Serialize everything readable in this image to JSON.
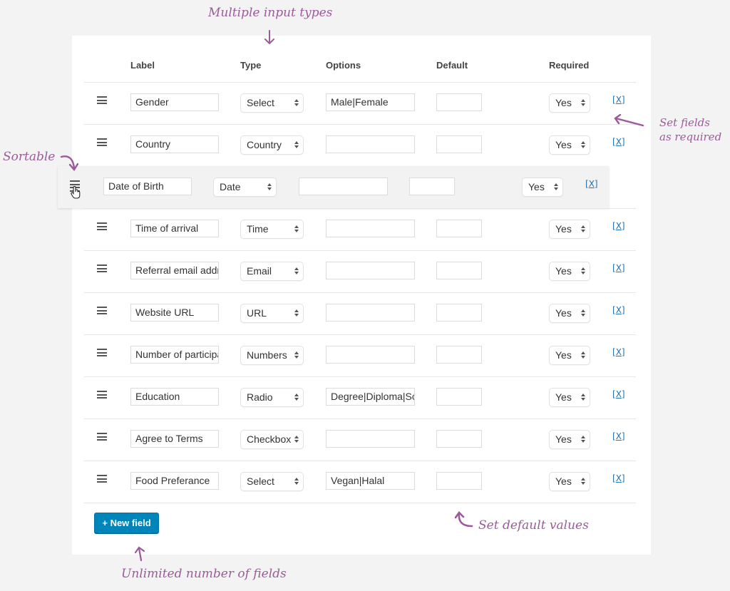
{
  "annotations": {
    "input_types": "Multiple input types",
    "sortable": "Sortable",
    "required": [
      "Set fields",
      "as required"
    ],
    "default_values": "Set default values",
    "unlimited": "Unlimited number of fields"
  },
  "table": {
    "headers": {
      "label": "Label",
      "type": "Type",
      "options": "Options",
      "default": "Default",
      "required": "Required"
    },
    "delete_label_open": "[",
    "delete_label_x": "X",
    "delete_label_close": "]",
    "rows": [
      {
        "label": "Gender",
        "type": "Select",
        "options": "Male|Female",
        "default": "",
        "required": "Yes"
      },
      {
        "label": "Country",
        "type": "Country",
        "options": "",
        "default": "",
        "required": "Yes"
      },
      {
        "label": "Date of Birth",
        "type": "Date",
        "options": "",
        "default": "",
        "required": "Yes",
        "dragging": true
      },
      {
        "label": "Time of arrival",
        "type": "Time",
        "options": "",
        "default": "",
        "required": "Yes"
      },
      {
        "label": "Referral email address",
        "type": "Email",
        "options": "",
        "default": "",
        "required": "Yes"
      },
      {
        "label": "Website URL",
        "type": "URL",
        "options": "",
        "default": "",
        "required": "Yes"
      },
      {
        "label": "Number of participants",
        "type": "Numbers",
        "options": "",
        "default": "",
        "required": "Yes"
      },
      {
        "label": "Education",
        "type": "Radio",
        "options": "Degree|Diploma|Some",
        "default": "",
        "required": "Yes"
      },
      {
        "label": "Agree to Terms",
        "type": "Checkbox",
        "options": "",
        "default": "",
        "required": "Yes"
      },
      {
        "label": "Food Preferance",
        "type": "Select",
        "options": "Vegan|Halal",
        "default": "",
        "required": "Yes"
      }
    ]
  },
  "new_field_button": "+ New field",
  "colors": {
    "accent": "#0085ba",
    "annotation": "#9b5b9b",
    "link": "#2271b1"
  }
}
